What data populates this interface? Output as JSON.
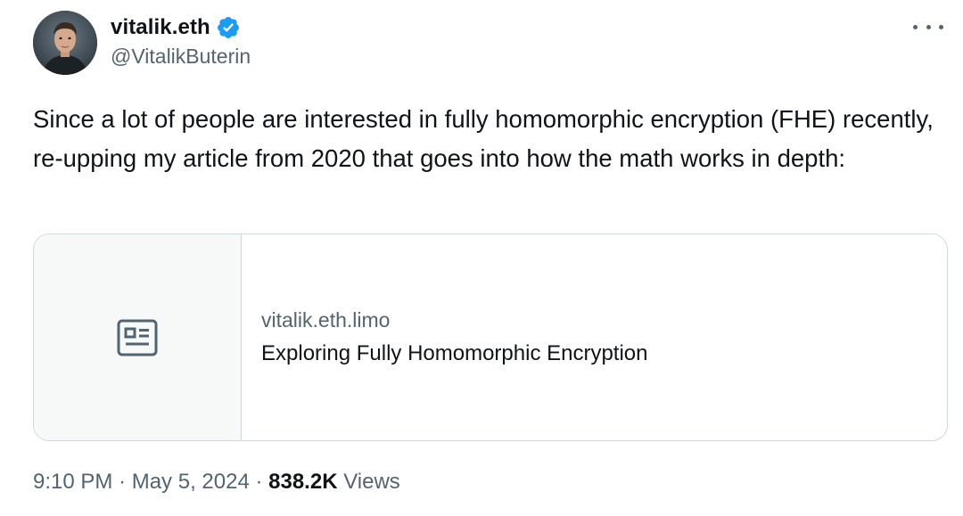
{
  "author": {
    "display_name": "vitalik.eth",
    "handle": "@VitalikButerin",
    "verified": true,
    "verified_color": "#1d9bf0"
  },
  "tweet": {
    "text": "Since a lot of people are interested in fully homomorphic encryption (FHE) recently, re-upping my article from 2020 that goes into how the math works in depth:"
  },
  "link_card": {
    "domain": "vitalik.eth.limo",
    "title": "Exploring Fully Homomorphic Encryption",
    "icon": "article-icon"
  },
  "meta": {
    "time": "9:10 PM",
    "separator_1": " · ",
    "date": "May 5, 2024",
    "separator_2": " · ",
    "views_count": "838.2K",
    "views_label": " Views"
  },
  "more_menu_icon": "more-horizontal-icon"
}
